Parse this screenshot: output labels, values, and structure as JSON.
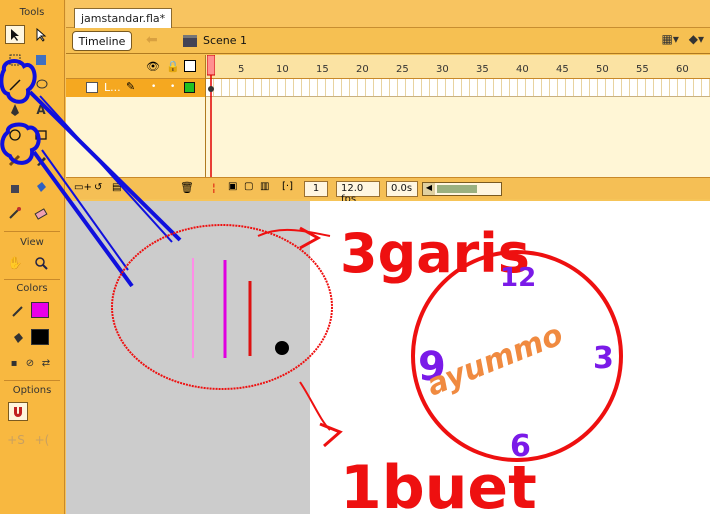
{
  "tools": {
    "title": "Tools",
    "view_title": "View",
    "colors_title": "Colors",
    "options_title": "Options"
  },
  "document": {
    "tab_title": "jamstandar.fla*",
    "timeline_button": "Timeline",
    "scene_label": "Scene 1"
  },
  "timeline": {
    "ruler": [
      "1",
      "5",
      "10",
      "15",
      "20",
      "25",
      "30",
      "35",
      "40",
      "45",
      "50",
      "55",
      "60"
    ],
    "layer_name": "L...",
    "frame": "1",
    "fps": "12.0 fps",
    "time": "0.0s"
  },
  "annotations": {
    "lines_text": "3garis",
    "dot_text": "1buet",
    "clock_name": "ayummo",
    "clock_12": "12",
    "clock_3": "3",
    "clock_6": "6",
    "clock_9": "9"
  },
  "colors": {
    "stroke": "#e800e8",
    "fill": "#000000",
    "pink_line": "#ff8ce8",
    "magenta_line": "#e000e0",
    "red_line": "#dd1111",
    "annotation_red": "#ee1010",
    "annotation_blue": "#1010dd",
    "clock_numbers": "#7a1ae8",
    "clock_name": "#f08a40"
  }
}
